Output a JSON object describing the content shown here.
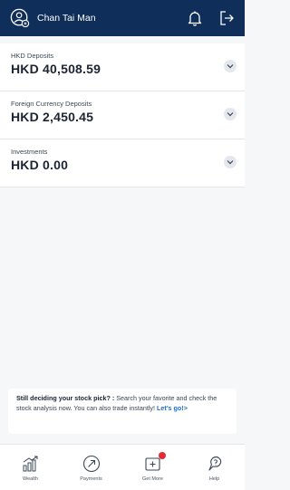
{
  "header": {
    "user_name": "Chan Tai Man"
  },
  "accounts": [
    {
      "label": "HKD Deposits",
      "amount": "HKD 40,508.59"
    },
    {
      "label": "Foreign Currency Deposits",
      "amount": "HKD 2,450.45"
    },
    {
      "label": "Investments",
      "amount": "HKD 0.00"
    }
  ],
  "promo": {
    "bold": "Still deciding your stock pick? :",
    "body": " Search your favorite and check the stock analysis now. You can also trade instantly! ",
    "link": "Let's go!>"
  },
  "tabs": [
    {
      "label": "Wealth",
      "icon": "wealth-icon"
    },
    {
      "label": "Payments",
      "icon": "payments-icon"
    },
    {
      "label": "Get More",
      "icon": "get-more-icon"
    },
    {
      "label": "Help",
      "icon": "help-icon"
    }
  ],
  "colors": {
    "header_bg": "#0f2f5a",
    "link": "#1a6fd4",
    "badge": "#e22b36"
  }
}
